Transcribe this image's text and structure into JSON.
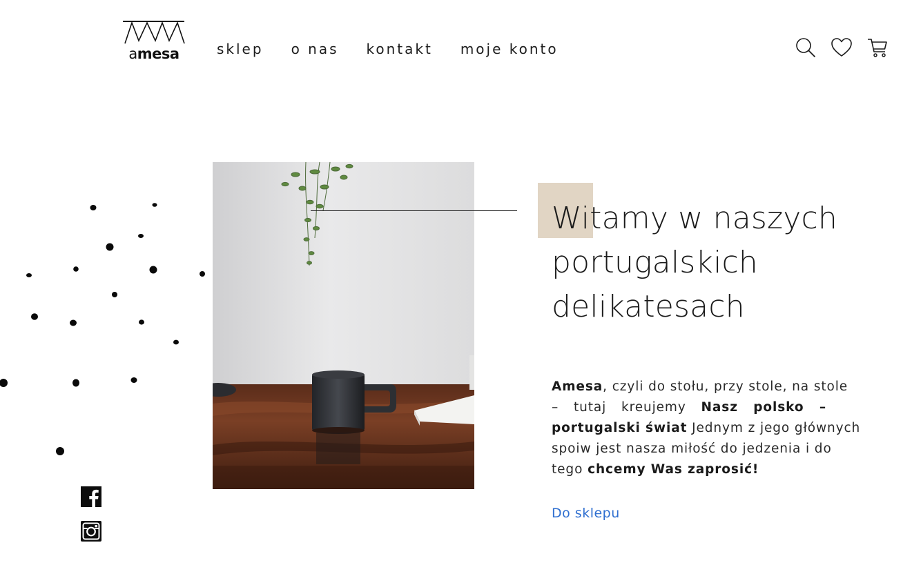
{
  "brand": {
    "logo_prefix": "a",
    "logo_suffix": "mesa"
  },
  "nav": {
    "items": [
      {
        "label": "sklep"
      },
      {
        "label": "o nas"
      },
      {
        "label": "kontakt"
      },
      {
        "label": "moje konto"
      }
    ]
  },
  "header_icons": [
    "search-icon",
    "heart-icon",
    "cart-icon"
  ],
  "hero": {
    "title_lines": [
      "Witamy w naszych",
      "portugalskich",
      "delikatesach"
    ],
    "paragraph": {
      "line1": {
        "b1": "Amesa",
        "t1": ", czyli do stołu, przy stole, na stole"
      },
      "line2": {
        "t1": "– tutaj kreujemy ",
        "b1": "Nasz polsko –"
      },
      "line3": {
        "b1": "portugalski świat",
        "t1": " Jednym z jego głównych"
      },
      "line4": {
        "t1": "spoiw jest nasza miłość do jedzenia i do"
      },
      "line5": {
        "t1": "tego ",
        "b1": "chcemy Was zaprosić!"
      }
    },
    "cta_label": "Do sklepu"
  },
  "social": [
    "facebook-icon",
    "instagram-icon"
  ],
  "colors": {
    "accent_square": "#e1d5c4",
    "link": "#2f6fd0",
    "text": "#1f1f1f",
    "line": "#1a1a1a"
  }
}
